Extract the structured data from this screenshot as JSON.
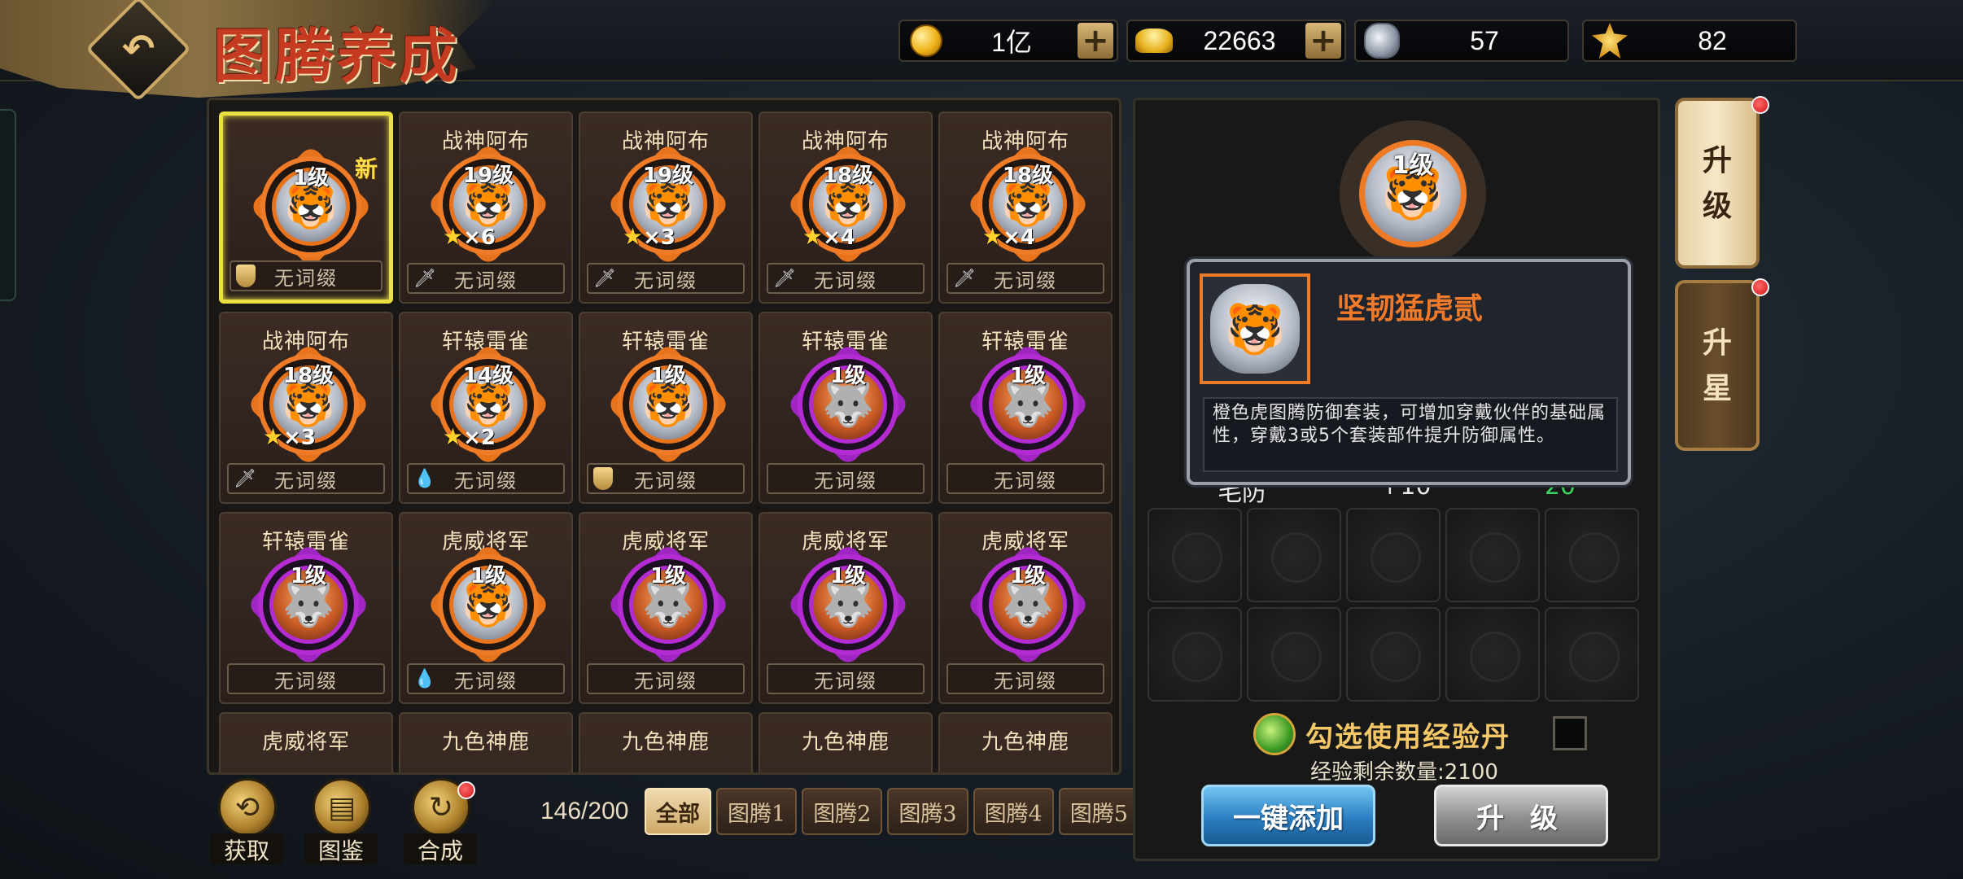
{
  "header": {
    "title": "图腾养成",
    "back_icon": "back-arrow-icon"
  },
  "currencies": [
    {
      "icon": "gold-coin-icon",
      "value": "1亿",
      "has_plus": true
    },
    {
      "icon": "gold-ingot-icon",
      "value": "22663",
      "has_plus": true
    },
    {
      "icon": "tiger-token-icon",
      "value": "57",
      "has_plus": false
    },
    {
      "icon": "gold-star-token-icon",
      "value": "82",
      "has_plus": false
    }
  ],
  "grid": {
    "cards": [
      {
        "name": "",
        "level": "1级",
        "stars": "",
        "multiplier": "",
        "frame": "orange",
        "face": "tiger",
        "slot": "shield",
        "affix": "无词缀",
        "is_new": true,
        "new_label": "新",
        "selected": true
      },
      {
        "name": "战神阿布",
        "level": "19级",
        "stars": "★",
        "multiplier": "×6",
        "frame": "orange",
        "face": "tiger",
        "slot": "sword",
        "affix": "无词缀"
      },
      {
        "name": "战神阿布",
        "level": "19级",
        "stars": "★",
        "multiplier": "×3",
        "frame": "orange",
        "face": "tiger",
        "slot": "sword",
        "affix": "无词缀"
      },
      {
        "name": "战神阿布",
        "level": "18级",
        "stars": "★",
        "multiplier": "×4",
        "frame": "orange",
        "face": "tiger",
        "slot": "sword",
        "affix": "无词缀"
      },
      {
        "name": "战神阿布",
        "level": "18级",
        "stars": "★",
        "multiplier": "×4",
        "frame": "orange",
        "face": "tiger",
        "slot": "sword",
        "affix": "无词缀"
      },
      {
        "name": "战神阿布",
        "level": "18级",
        "stars": "★",
        "multiplier": "×3",
        "frame": "orange",
        "face": "tiger",
        "slot": "sword",
        "affix": "无词缀"
      },
      {
        "name": "轩辕雷雀",
        "level": "14级",
        "stars": "★",
        "multiplier": "×2",
        "frame": "orange",
        "face": "tiger",
        "slot": "drop",
        "affix": "无词缀"
      },
      {
        "name": "轩辕雷雀",
        "level": "1级",
        "stars": "",
        "multiplier": "",
        "frame": "orange",
        "face": "tiger",
        "slot": "shield",
        "affix": "无词缀"
      },
      {
        "name": "轩辕雷雀",
        "level": "1级",
        "stars": "",
        "multiplier": "",
        "frame": "purple",
        "face": "wolf",
        "slot": "",
        "affix": "无词缀"
      },
      {
        "name": "轩辕雷雀",
        "level": "1级",
        "stars": "",
        "multiplier": "",
        "frame": "purple",
        "face": "wolf",
        "slot": "",
        "affix": "无词缀"
      },
      {
        "name": "轩辕雷雀",
        "level": "1级",
        "stars": "",
        "multiplier": "",
        "frame": "purple",
        "face": "wolf",
        "slot": "",
        "affix": "无词缀"
      },
      {
        "name": "虎威将军",
        "level": "1级",
        "stars": "",
        "multiplier": "",
        "frame": "orange",
        "face": "tiger",
        "slot": "drop",
        "affix": "无词缀"
      },
      {
        "name": "虎威将军",
        "level": "1级",
        "stars": "",
        "multiplier": "",
        "frame": "purple",
        "face": "wolf",
        "slot": "",
        "affix": "无词缀"
      },
      {
        "name": "虎威将军",
        "level": "1级",
        "stars": "",
        "multiplier": "",
        "frame": "purple",
        "face": "wolf",
        "slot": "",
        "affix": "无词缀"
      },
      {
        "name": "虎威将军",
        "level": "1级",
        "stars": "",
        "multiplier": "",
        "frame": "purple",
        "face": "wolf",
        "slot": "",
        "affix": "无词缀"
      },
      {
        "name": "虎威将军",
        "partial": true
      },
      {
        "name": "九色神鹿",
        "partial": true
      },
      {
        "name": "九色神鹿",
        "partial": true
      },
      {
        "name": "九色神鹿",
        "partial": true
      },
      {
        "name": "九色神鹿",
        "partial": true
      }
    ]
  },
  "bottom_left": {
    "buttons": [
      {
        "label": "获取",
        "icon": "acquire-icon",
        "badge": false
      },
      {
        "label": "图鉴",
        "icon": "codex-icon",
        "badge": false
      },
      {
        "label": "合成",
        "icon": "synthesize-icon",
        "badge": true
      }
    ]
  },
  "inventory_count": "146/200",
  "filter_tabs": [
    {
      "label": "全部",
      "active": true
    },
    {
      "label": "图腾1",
      "active": false
    },
    {
      "label": "图腾2",
      "active": false
    },
    {
      "label": "图腾3",
      "active": false
    },
    {
      "label": "图腾4",
      "active": false
    },
    {
      "label": "图腾5",
      "active": false
    }
  ],
  "detail": {
    "level": "1级",
    "tooltip": {
      "name": "坚韧猛虎贰",
      "description": "橙色虎图腾防御套装，可增加穿戴伙伴的基础属性，穿戴3或5个套装部件提升防御属性。"
    },
    "stat": {
      "label": "毛防",
      "value": "+10",
      "bonus": "20"
    },
    "exp_checkbox_label": "勾选使用经验丹",
    "exp_remaining": "经验剩余数量:2100",
    "add_all_label": "一键添加",
    "upgrade_label": "升 级"
  },
  "side_tabs": [
    {
      "label_top": "升",
      "label_bottom": "级",
      "active": true,
      "badge": true
    },
    {
      "label_top": "升",
      "label_bottom": "星",
      "active": false,
      "badge": true
    }
  ],
  "colors": {
    "orange_frame": "#f07b27",
    "purple_frame": "#b42bd3",
    "selected_border": "#e9e042",
    "title_red": "#c43b22"
  }
}
